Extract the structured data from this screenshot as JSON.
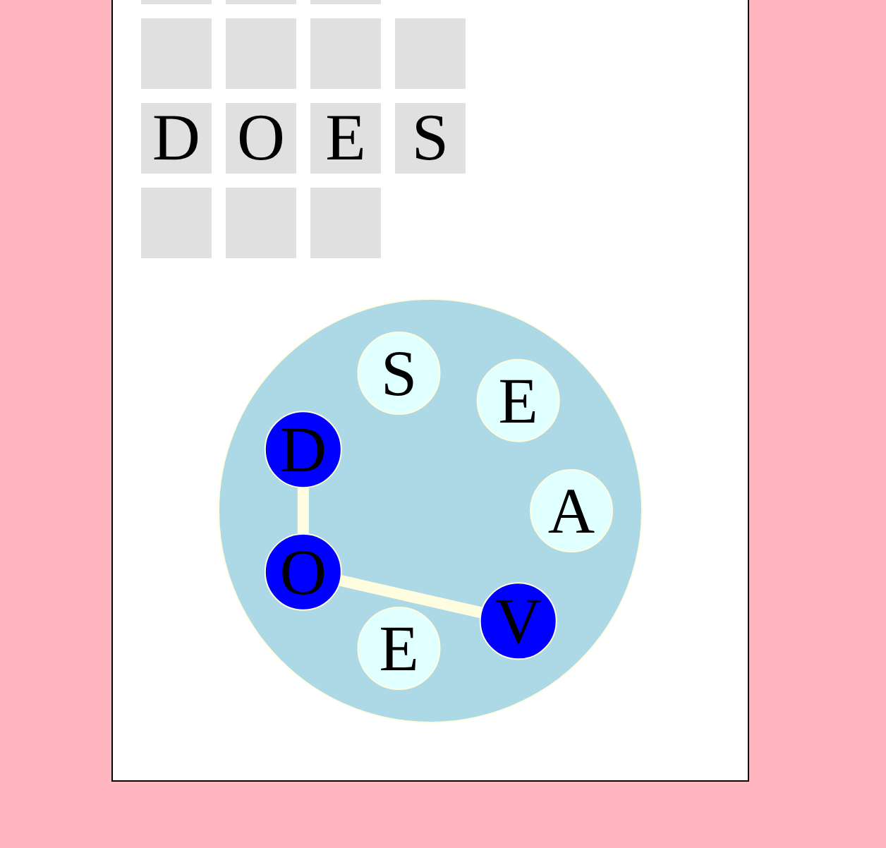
{
  "grid": {
    "rows": [
      {
        "tiles": [
          {
            "kind": "blank"
          },
          {
            "kind": "blank"
          },
          {
            "kind": "blank"
          }
        ]
      },
      {
        "tiles": [
          {
            "kind": "blank"
          },
          {
            "kind": "blank"
          },
          {
            "kind": "blank"
          },
          {
            "kind": "blank"
          }
        ]
      },
      {
        "tiles": [
          {
            "kind": "letter",
            "letter": "D"
          },
          {
            "kind": "letter",
            "letter": "O"
          },
          {
            "kind": "letter",
            "letter": "E"
          },
          {
            "kind": "letter",
            "letter": "S"
          }
        ]
      },
      {
        "tiles": [
          {
            "kind": "blank"
          },
          {
            "kind": "blank"
          },
          {
            "kind": "blank"
          }
        ]
      }
    ]
  },
  "wheel": {
    "letters": [
      {
        "letter": "S",
        "selected": false
      },
      {
        "letter": "E",
        "selected": false
      },
      {
        "letter": "A",
        "selected": false
      },
      {
        "letter": "V",
        "selected": true
      },
      {
        "letter": "E",
        "selected": false
      },
      {
        "letter": "O",
        "selected": true
      },
      {
        "letter": "D",
        "selected": true
      }
    ]
  }
}
